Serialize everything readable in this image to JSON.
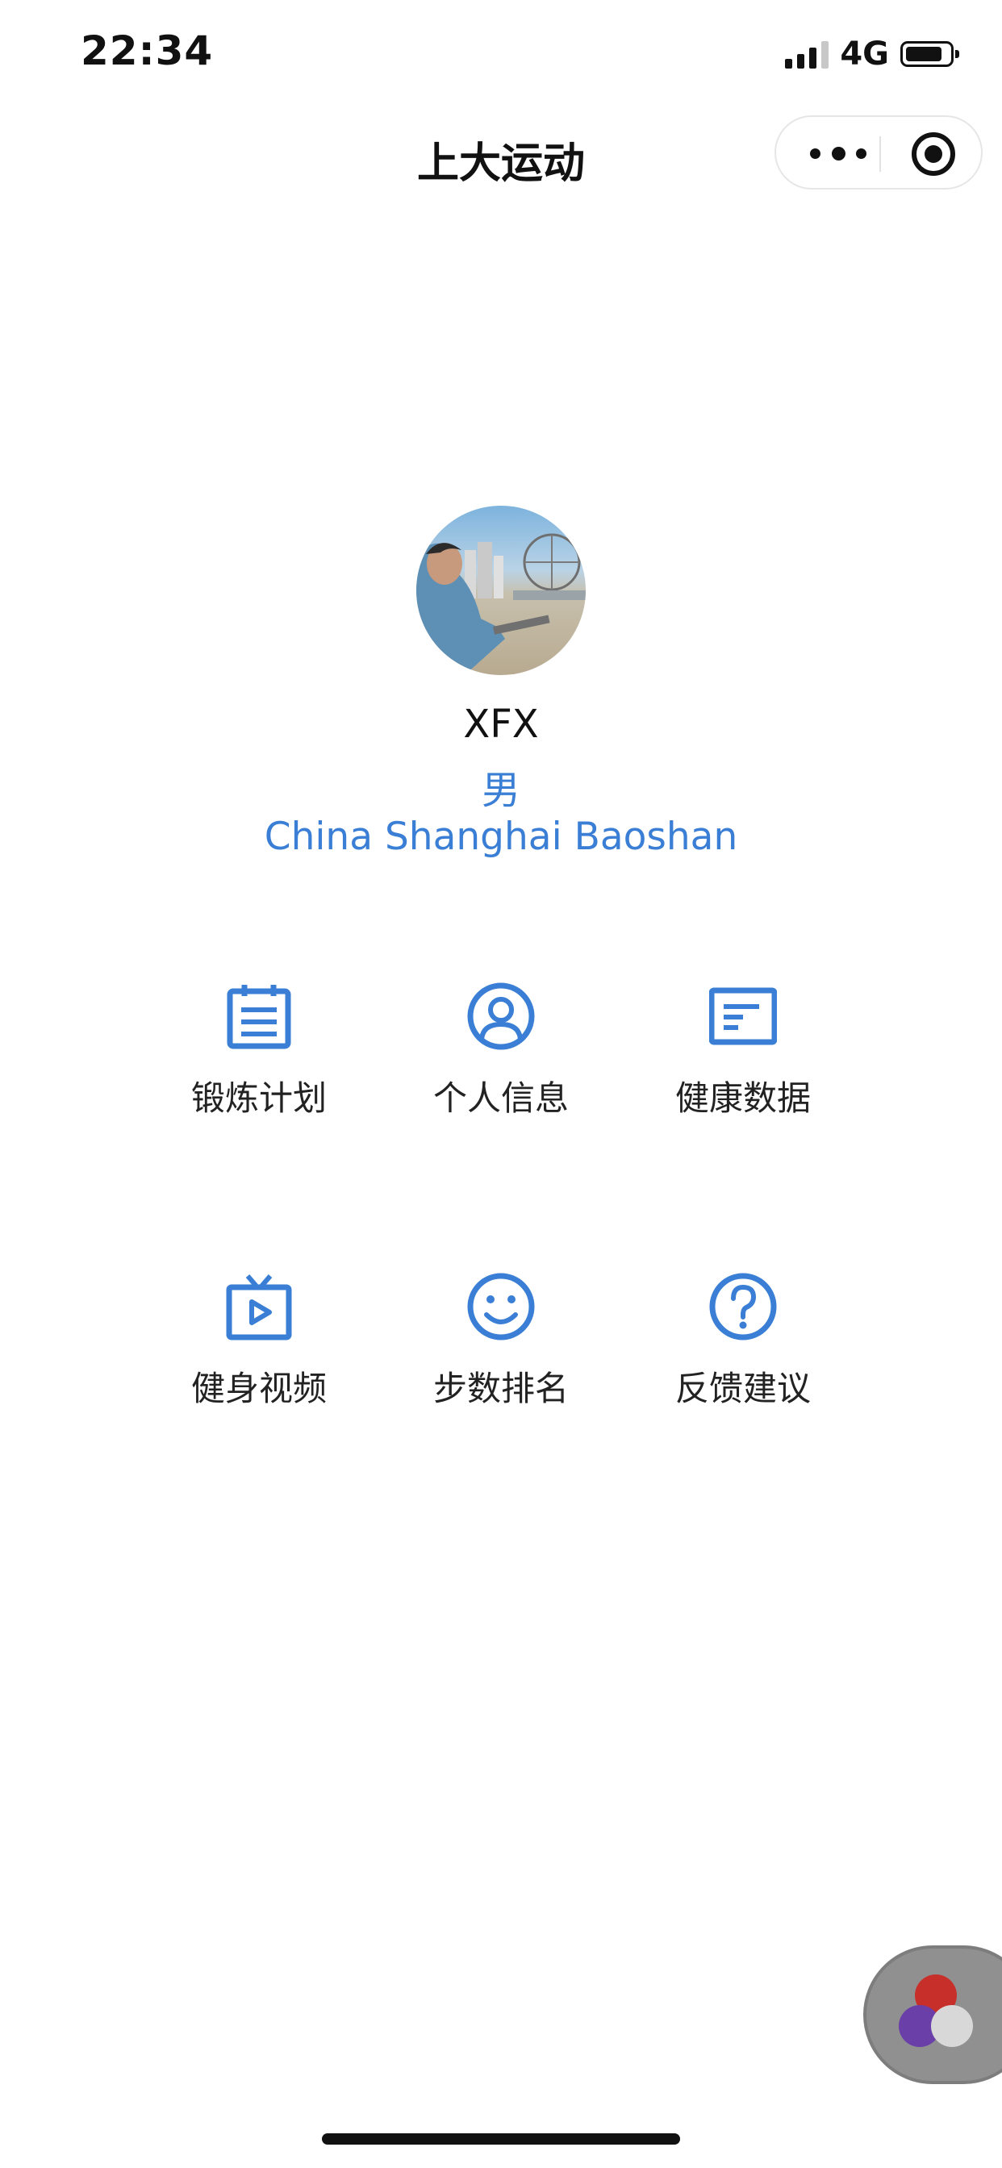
{
  "status_bar": {
    "time": "22:34",
    "network": "4G",
    "signal_bars": 3,
    "battery_level": 0.8
  },
  "nav": {
    "title": "上大运动",
    "more_icon": "more-dots-icon",
    "close_icon": "target-icon"
  },
  "profile": {
    "avatar_icon": "user-avatar-photo",
    "name": "XFX",
    "gender": "男",
    "location": "China Shanghai Baoshan"
  },
  "menu": [
    {
      "label": "锻炼计划",
      "icon": "calendar-icon"
    },
    {
      "label": "个人信息",
      "icon": "user-circle-icon"
    },
    {
      "label": "健康数据",
      "icon": "data-card-icon"
    },
    {
      "label": "健身视频",
      "icon": "tv-play-icon"
    },
    {
      "label": "步数排名",
      "icon": "smile-icon"
    },
    {
      "label": "反馈建议",
      "icon": "question-icon"
    }
  ],
  "colors": {
    "accent": "#3a7fd5",
    "text": "#111111"
  }
}
